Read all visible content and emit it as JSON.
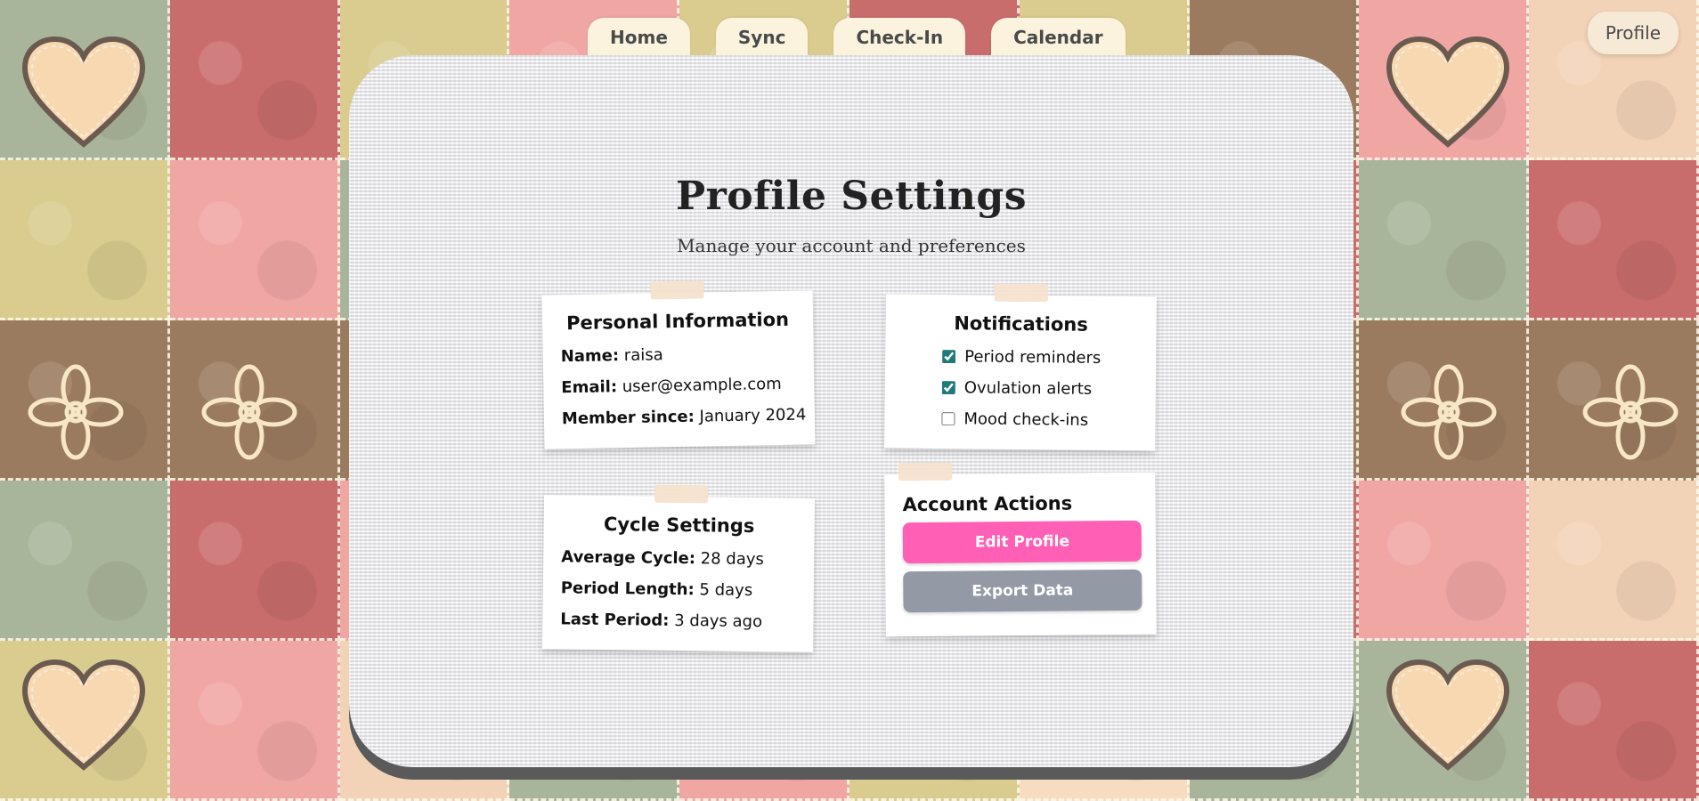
{
  "nav": {
    "tabs": [
      {
        "label": "Home"
      },
      {
        "label": "Sync"
      },
      {
        "label": "Check-In"
      },
      {
        "label": "Calendar"
      }
    ],
    "profile_label": "Profile"
  },
  "page": {
    "title": "Profile Settings",
    "subtitle": "Manage your account and preferences"
  },
  "personal_info": {
    "heading": "Personal Information",
    "fields": [
      {
        "label": "Name:",
        "value": "raisa"
      },
      {
        "label": "Email:",
        "value": "user@example.com"
      },
      {
        "label": "Member since:",
        "value": "January 2024"
      }
    ]
  },
  "notifications": {
    "heading": "Notifications",
    "options": [
      {
        "label": "Period reminders",
        "checked": true
      },
      {
        "label": "Ovulation alerts",
        "checked": true
      },
      {
        "label": "Mood check-ins",
        "checked": false
      }
    ]
  },
  "cycle_settings": {
    "heading": "Cycle Settings",
    "fields": [
      {
        "label": "Average Cycle:",
        "value": "28 days"
      },
      {
        "label": "Period Length:",
        "value": "5 days"
      },
      {
        "label": "Last Period:",
        "value": "3 days ago"
      }
    ]
  },
  "account_actions": {
    "heading": "Account Actions",
    "edit_profile_label": "Edit Profile",
    "export_data_label": "Export Data"
  },
  "colors": {
    "edit_button": "#ff5fb4",
    "export_button": "#939aa6",
    "checkbox_accent": "#1f7a7a"
  }
}
